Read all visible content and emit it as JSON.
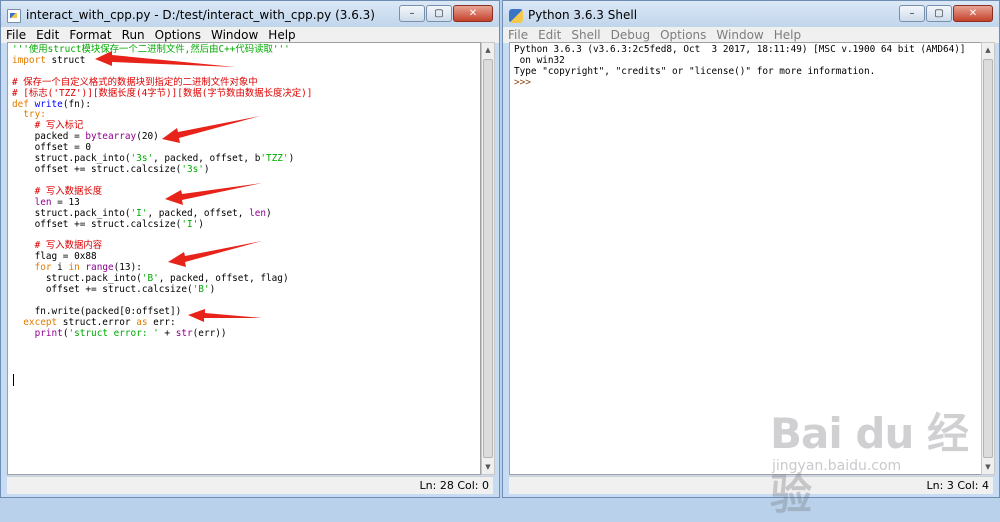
{
  "editor_window": {
    "title": "interact_with_cpp.py - D:/test/interact_with_cpp.py (3.6.3)",
    "menu": [
      "File",
      "Edit",
      "Format",
      "Run",
      "Options",
      "Window",
      "Help"
    ],
    "code": {
      "l1": "'''使用struct模块保存一个二进制文件,然后由C++代码读取'''",
      "l2a": "import",
      "l2b": " struct",
      "l4": "# 保存一个自定义格式的数据块到指定的二进制文件对象中",
      "l5": "# [标志('TZZ')][数据长度(4字节)][数据(字节数由数据长度决定)]",
      "l6a": "def",
      "l6b": "write",
      "l6c": "(fn):",
      "l7": "  try:",
      "l8": "    # 写入标记",
      "l9a": "    packed = ",
      "l9b": "bytearray",
      "l9c": "(20)",
      "l10": "    offset = 0",
      "l11a": "    struct.pack_into(",
      "l11b": "'3s'",
      "l11c": ", packed, offset, b",
      "l11d": "'TZZ'",
      "l11e": ")",
      "l12a": "    offset += struct.calcsize(",
      "l12b": "'3s'",
      "l12c": ")",
      "l14": "    # 写入数据长度",
      "l15a": "    len",
      "l15b": " = 13",
      "l16a": "    struct.pack_into(",
      "l16b": "'I'",
      "l16c": ", packed, offset, ",
      "l16d": "len",
      "l16e": ")",
      "l17a": "    offset += struct.calcsize(",
      "l17b": "'I'",
      "l17c": ")",
      "l19": "    # 写入数据内容",
      "l20": "    flag = 0x88",
      "l21a": "    for",
      "l21b": " i ",
      "l21c": "in",
      "l21d": " ",
      "l21e": "range",
      "l21f": "(13):",
      "l22a": "      struct.pack_into(",
      "l22b": "'B'",
      "l22c": ", packed, offset, flag)",
      "l23a": "      offset += struct.calcsize(",
      "l23b": "'B'",
      "l23c": ")",
      "l25a": "    fn.write(packed[0:offset])",
      "l26a": "  except",
      "l26b": " struct.error ",
      "l26c": "as",
      "l26d": " err:",
      "l27a": "    ",
      "l27b": "print",
      "l27c": "(",
      "l27d": "'struct error: '",
      "l27e": " + ",
      "l27f": "str",
      "l27g": "(err))"
    },
    "status": "Ln: 28  Col: 0"
  },
  "shell_window": {
    "title": "Python 3.6.3 Shell",
    "menu": [
      "File",
      "Edit",
      "Shell",
      "Debug",
      "Options",
      "Window",
      "Help"
    ],
    "lines": [
      "Python 3.6.3 (v3.6.3:2c5fed8, Oct  3 2017, 18:11:49) [MSC v.1900 64 bit (AMD64)]",
      " on win32",
      "Type \"copyright\", \"credits\" or \"license()\" for more information."
    ],
    "prompt": ">>>",
    "status": "Ln: 3  Col: 4"
  },
  "window_buttons": {
    "minimize": "–",
    "maximize": "▢",
    "close": "✕"
  },
  "watermark": {
    "main": "Bai du 经验",
    "sub": "jingyan.baidu.com"
  },
  "colors": {
    "keyword": "#e37b00",
    "string": "#00aa00",
    "comment": "#dd0000",
    "builtin": "#900090",
    "def": "#0000ff",
    "arrow": "#e8231a"
  }
}
